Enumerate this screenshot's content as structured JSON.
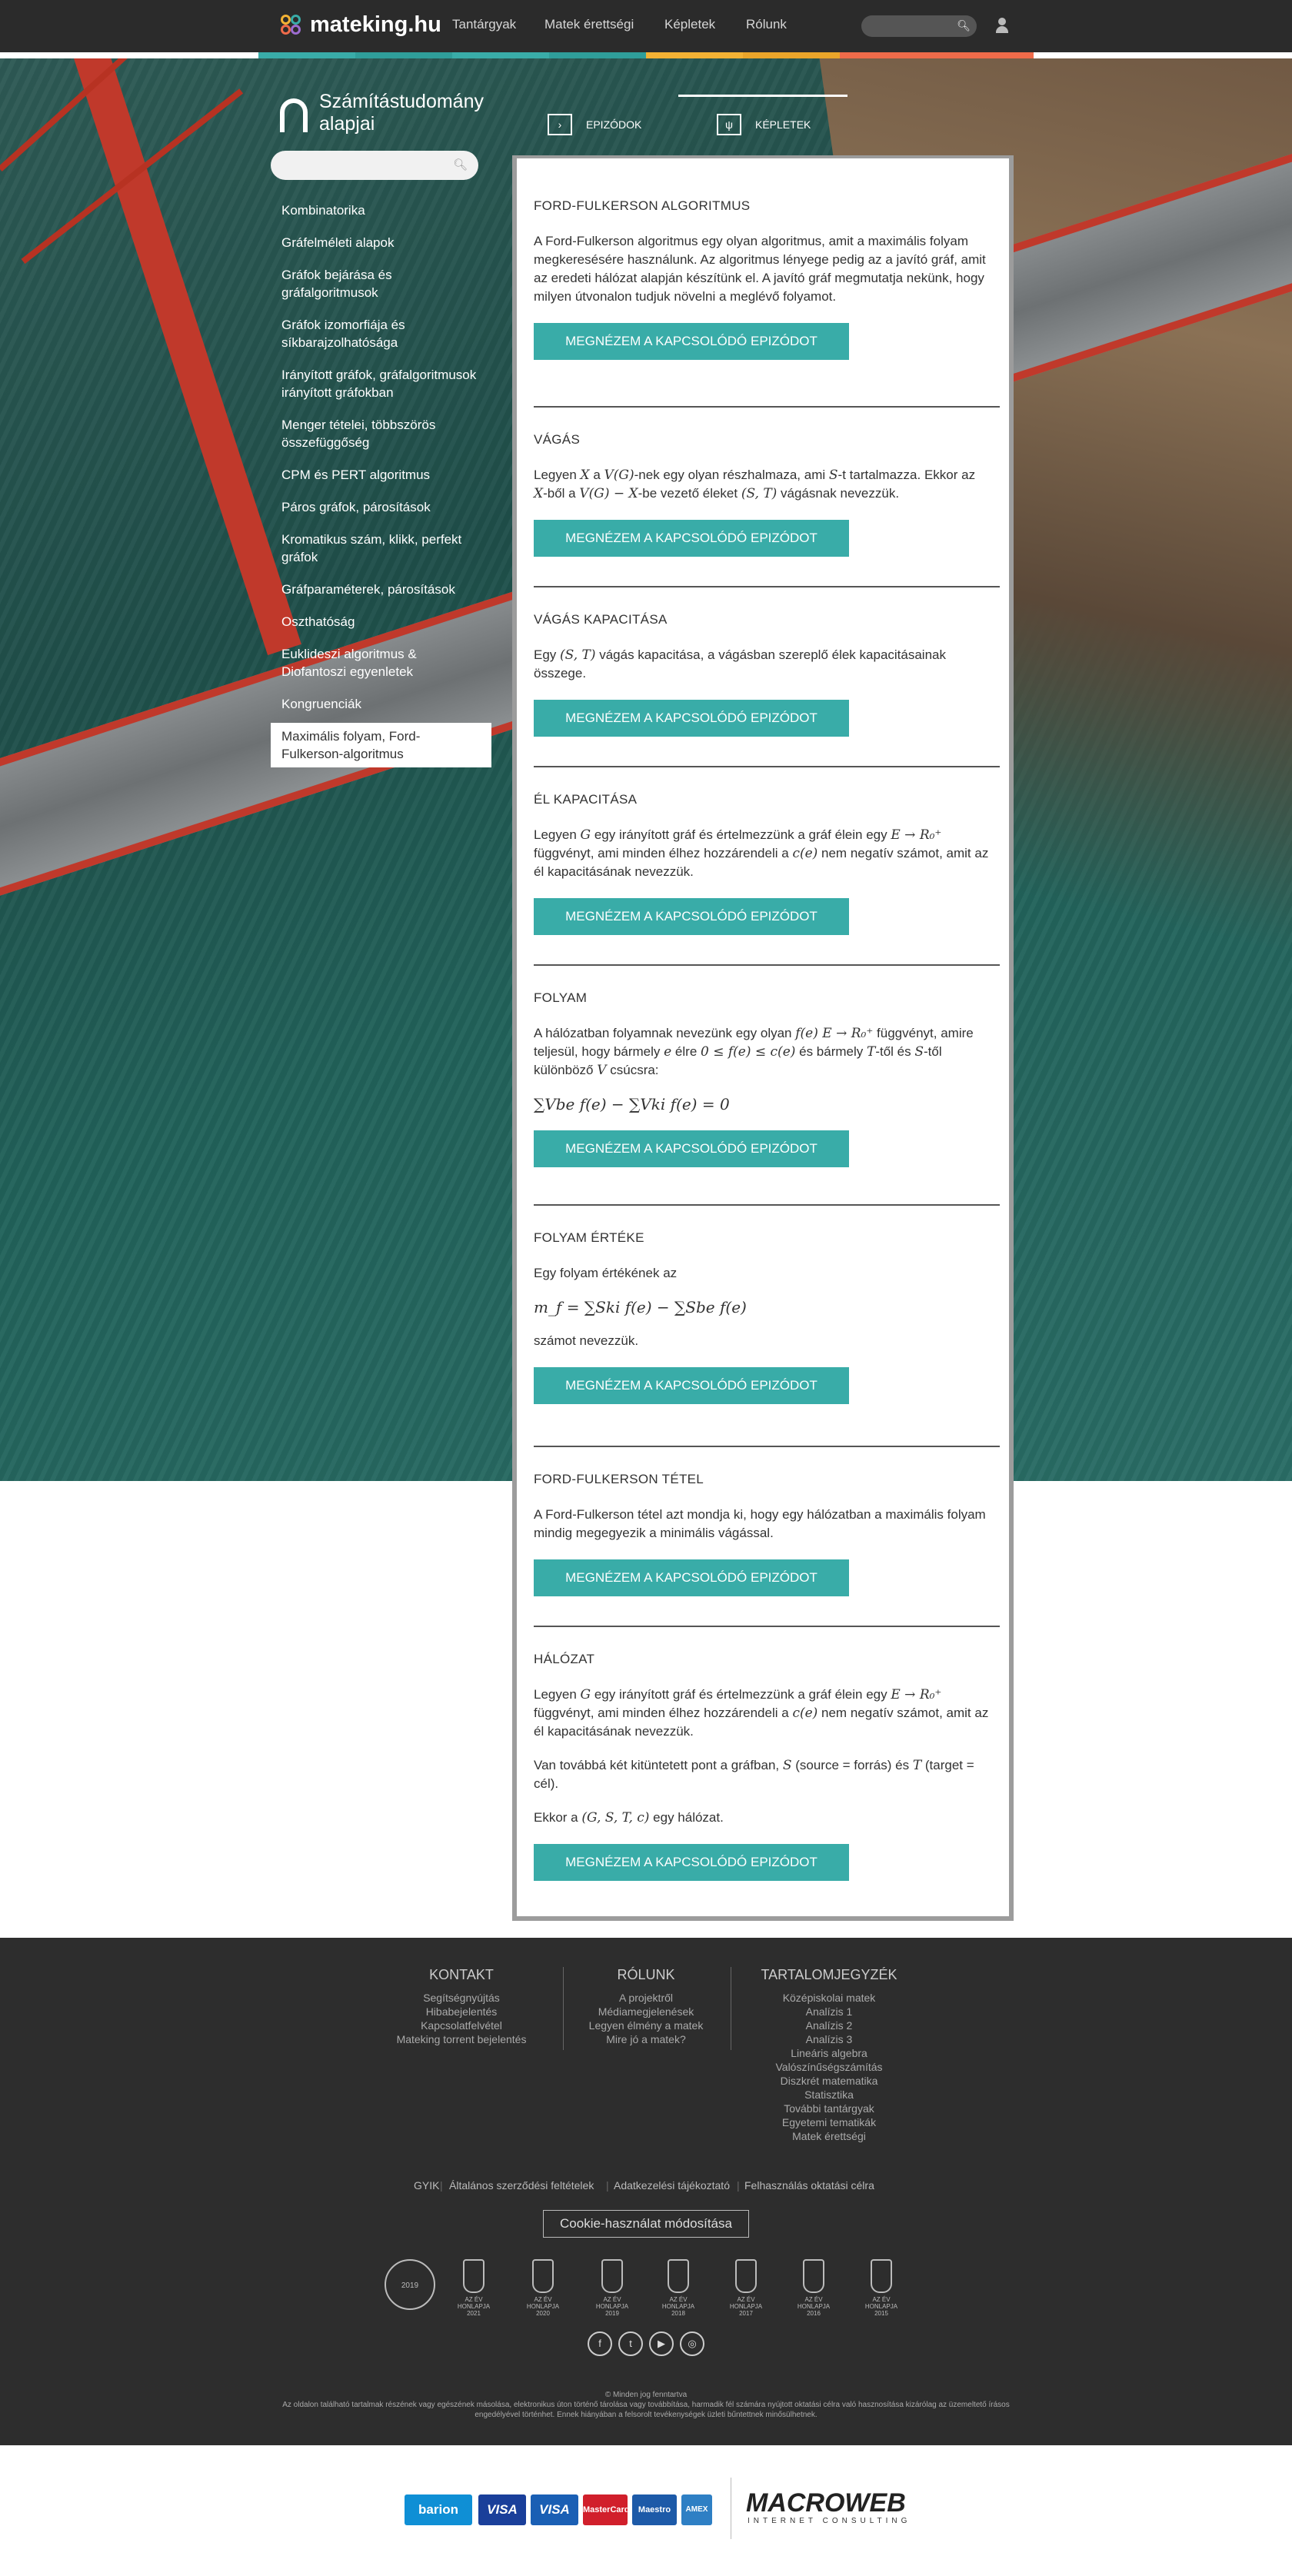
{
  "header": {
    "logo_text": "mateking.hu",
    "nav": [
      "Tantárgyak",
      "Matek érettségi",
      "Képletek",
      "Rólunk"
    ],
    "colors": [
      "#39aca8",
      "#39aca8",
      "#39aca8",
      "#39aca8",
      "#f3b234",
      "#f3b234",
      "#ef6b4a"
    ]
  },
  "sidebar": {
    "subject_title": "Számítástudomány alapjai",
    "items": [
      "Kombinatorika",
      "Gráfelméleti alapok",
      "Gráfok bejárása és gráfalgoritmusok",
      "Gráfok izomorfiája és síkbarajzolhatósága",
      "Irányított gráfok, gráfalgoritmusok irányított gráfokban",
      "Menger tételei, többszörös összefüggőség",
      "CPM és PERT algoritmus",
      "Páros gráfok, párosítások",
      "Kromatikus szám, klikk, perfekt gráfok",
      "Gráfparaméterek, párosítások",
      "Oszthatóság",
      "Euklideszi algoritmus & Diofantoszi egyenletek",
      "Kongruenciák",
      "Maximális folyam, Ford-Fulkerson-algoritmus"
    ]
  },
  "tabs": {
    "episodes": "EPIZÓDOK",
    "formulas": "KÉPLETEK",
    "episodes_icon": "›",
    "formulas_icon": "ψ"
  },
  "button_label": "MEGNÉZEM A KAPCSOLÓDÓ EPIZÓDOT",
  "sections": [
    {
      "title": "FORD-FULKERSON ALGORITMUS",
      "text": "A Ford-Fulkerson algoritmus egy olyan algoritmus, amit a maximális folyam megkeresésére használunk. Az algoritmus lényege pedig az a javító gráf, amit az eredeti hálózat alapján készítünk el. A javító gráf megmutatja nekünk, hogy milyen útvonalon tudjuk növelni a meglévő folyamot."
    },
    {
      "title": "VÁGÁS",
      "t1": "Legyen ",
      "m1": "X",
      "t2": " a ",
      "m2": "V(G)",
      "t3": "-nek egy olyan részhalmaza, ami ",
      "m3": "S",
      "t4": "-t tartalmazza. Ekkor az ",
      "m4": "X",
      "t5": "-ből a ",
      "m5": "V(G) − X",
      "t6": "-be vezető éleket ",
      "m6": "(S, T)",
      "t7": " vágásnak nevezzük."
    },
    {
      "title": "VÁGÁS KAPACITÁSA",
      "t1": "Egy ",
      "m1": "(S, T)",
      "t2": " vágás kapacitása, a vágásban szereplő élek kapacitásainak összege."
    },
    {
      "title": "ÉL KAPACITÁSA",
      "t1": "Legyen ",
      "m1": "G",
      "t2": " egy irányított gráf és értelmezzünk a gráf élein egy ",
      "m2": "E → R₀⁺",
      "t3": " függvényt, ami minden élhez hozzárendeli a ",
      "m3": "c(e)",
      "t4": " nem negatív számot, amit az él kapacitásának nevezzük."
    },
    {
      "title": "FOLYAM",
      "t1": "A hálózatban folyamnak nevezünk egy olyan ",
      "m1": "f(e) E → R₀⁺",
      "t2": " függvényt, amire teljesül, hogy bármely ",
      "m2": "e",
      "t3": " élre ",
      "m3": "0 ≤ f(e) ≤ c(e)",
      "t4": " és bármely ",
      "m4": "T",
      "t5": "-től és ",
      "m5": "S",
      "t6": "-től különböző ",
      "m6": "V",
      "t7": " csúcsra:",
      "formula": "∑Vbe f(e) − ∑Vki f(e) = 0"
    },
    {
      "title": "FOLYAM ÉRTÉKE",
      "t1": "Egy folyam értékének az",
      "formula": "m_f = ∑Ski f(e) − ∑Sbe f(e)",
      "t2": "számot nevezzük."
    },
    {
      "title": "FORD-FULKERSON TÉTEL",
      "text": "A Ford-Fulkerson tétel azt mondja ki, hogy egy hálózatban a maximális folyam mindig megegyezik a minimális vágással."
    },
    {
      "title": "HÁLÓZAT",
      "t1": "Legyen ",
      "m1": "G",
      "t2": " egy irányított gráf és értelmezzünk a gráf élein egy ",
      "m2": "E → R₀⁺",
      "t3": " függvényt, ami minden élhez hozzárendeli a ",
      "m3": "c(e)",
      "t4": " nem negatív számot, amit az él kapacitásának nevezzük.",
      "p2a": "Van továbbá két kitüntetett pont a gráfban, ",
      "p2m1": "S",
      "p2b": " (source = forrás) és ",
      "p2m2": "T",
      "p2c": " (target = cél).",
      "p3a": "Ekkor a ",
      "p3m": "(G, S, T, c)",
      "p3b": " egy hálózat."
    }
  ],
  "footer": {
    "contact": {
      "title": "KONTAKT",
      "links": [
        "Segítségnyújtás",
        "Hibabejelentés",
        "Kapcsolatfelvétel",
        "Mateking torrent bejelentés"
      ]
    },
    "about": {
      "title": "RÓLUNK",
      "links": [
        "A projektről",
        "Médiamegjelenések",
        "Legyen élmény a matek",
        "Mire jó a matek?"
      ]
    },
    "toc": {
      "title": "TARTALOMJEGYZÉK",
      "links": [
        "Középiskolai matek",
        "Analízis 1",
        "Analízis 2",
        "Analízis 3",
        "Lineáris algebra",
        "Valószínűségszámítás",
        "Diszkrét matematika",
        "Statisztika",
        "További tantárgyak",
        "Egyetemi tematikák",
        "Matek érettségi"
      ]
    },
    "legal": [
      "GYIK",
      "Általános szerződési feltételek",
      "Adatkezelési tájékoztató",
      "Felhasználás oktatási célra"
    ],
    "cookie": "Cookie-használat módosítása",
    "award_label": "AZ ÉV HONLAPJA",
    "award_years": [
      "2021",
      "2020",
      "2019",
      "2018",
      "2017",
      "2016",
      "2015"
    ],
    "seal_year": "2019",
    "social_icons": [
      "facebook-icon",
      "twitter-icon",
      "youtube-icon",
      "instagram-icon"
    ],
    "copyright": "© Minden jog fenntartva",
    "disclaimer1": "Az oldalon található tartalmak részének vagy egészének másolása, elektronikus úton történő tárolása vagy továbbítása, harmadik fél számára nyújtott oktatási célra való hasznosítása kizárólag az üzemeltető írásos",
    "disclaimer2": "engedélyével történhet. Ennek hiányában a felsorolt tevékenységek üzleti bűntettnek minősülhetnek."
  },
  "payment": {
    "barion": "barion",
    "visa1": "VISA",
    "visa2": "VISA",
    "mastercard": "MasterCard",
    "maestro": "Maestro",
    "amex": "AMEX",
    "macroweb": "MACROWEB",
    "macroweb_sub": "INTERNET CONSULTING"
  }
}
